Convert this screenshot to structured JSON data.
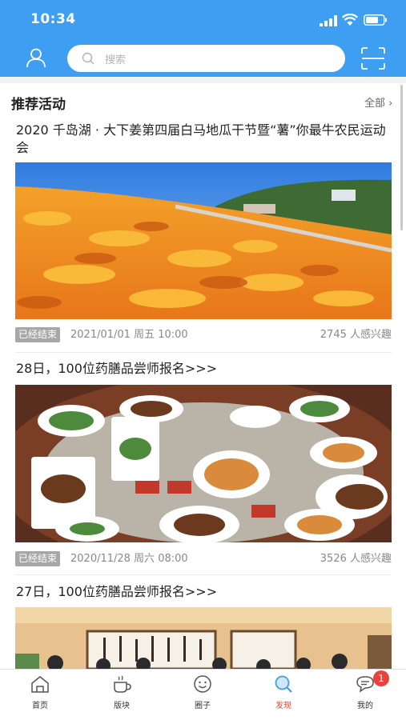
{
  "status_bar": {
    "time": "10:34"
  },
  "header": {
    "search_placeholder": "搜索"
  },
  "section": {
    "title": "推荐活动",
    "all_label": "全部 ›"
  },
  "cards": [
    {
      "title": "2020 千岛湖 · 大下姜第四届白马地瓜干节暨“薯”你最牛农民运动会",
      "status": "已经结束",
      "date": "2021/01/01 周五 10:00",
      "interest": "2745 人感兴趣"
    },
    {
      "title": "28日，100位药膳品尝师报名>>>",
      "status": "已经结束",
      "date": "2020/11/28 周六 08:00",
      "interest": "3526 人感兴趣"
    },
    {
      "title": "27日，100位药膳品尝师报名>>>"
    }
  ],
  "tabbar": {
    "items": [
      {
        "label": "首页"
      },
      {
        "label": "版块"
      },
      {
        "label": "圈子"
      },
      {
        "label": "发现"
      },
      {
        "label": "我的"
      }
    ],
    "active_color": "#e04a3b",
    "message_badge": "1"
  },
  "colors": {
    "header_blue": "#3e9ef2",
    "badge_gray": "#a7a7a7"
  }
}
